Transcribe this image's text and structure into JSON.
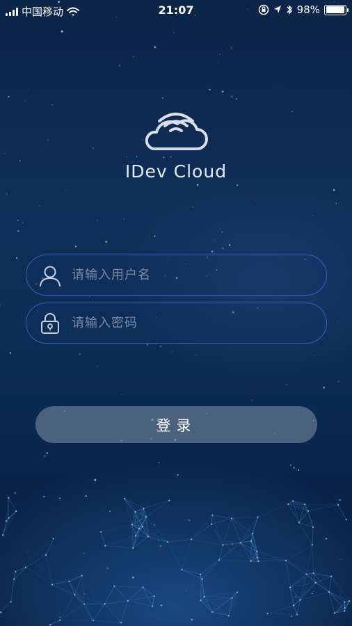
{
  "status_bar": {
    "carrier": "中国移动",
    "time": "21:07",
    "battery_text": "98%",
    "battery_level": 0.98,
    "icons": [
      "signal-icon",
      "wifi-icon",
      "orientation-lock-icon",
      "location-icon",
      "bluetooth-icon",
      "battery-icon"
    ]
  },
  "logo": {
    "icon": "cloud-wifi-icon",
    "text": "IDev Cloud"
  },
  "form": {
    "username_placeholder": "请输入用户名",
    "username_value": "",
    "username_icon": "user-icon",
    "password_placeholder": "请输入密码",
    "password_value": "",
    "password_icon": "lock-icon",
    "login_label": "登录"
  },
  "colors": {
    "background_top": "#0c2548",
    "background_bottom": "#071a38",
    "field_border": "#2a64c6",
    "placeholder": "#7a8aa3",
    "button_bg": "#828fa5"
  }
}
